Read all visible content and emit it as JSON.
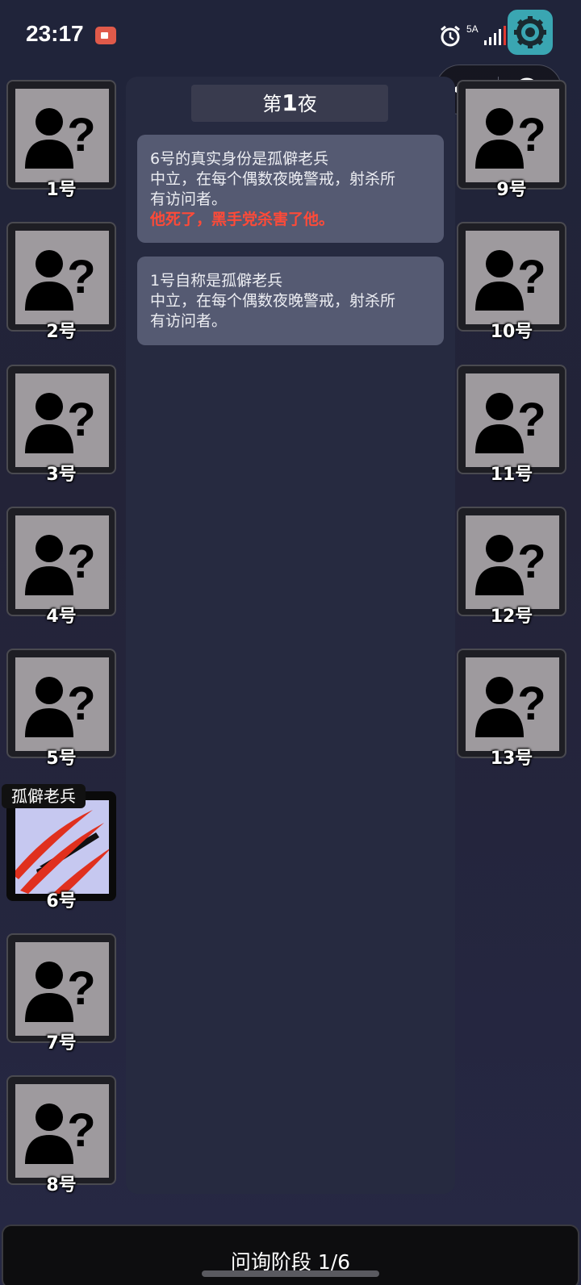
{
  "status_bar": {
    "time": "23:17",
    "network": "5A",
    "icons": [
      "record-icon",
      "alarm-icon",
      "signal-icon",
      "settings-icon"
    ]
  },
  "capsule": {
    "icons": [
      "more-icon",
      "close-target-icon"
    ]
  },
  "players_left": [
    {
      "label": "1号",
      "icon": "unknown-person-icon"
    },
    {
      "label": "2号",
      "icon": "unknown-person-icon"
    },
    {
      "label": "3号",
      "icon": "unknown-person-icon"
    },
    {
      "label": "4号",
      "icon": "unknown-person-icon"
    },
    {
      "label": "5号",
      "icon": "unknown-person-icon"
    },
    {
      "label": "6号",
      "icon": "dead-veteran-icon",
      "role": "孤僻老兵",
      "dead": true
    },
    {
      "label": "7号",
      "icon": "unknown-person-icon"
    },
    {
      "label": "8号",
      "icon": "unknown-person-icon"
    }
  ],
  "players_right": [
    {
      "label": "9号",
      "icon": "unknown-person-icon"
    },
    {
      "label": "10号",
      "icon": "unknown-person-icon"
    },
    {
      "label": "11号",
      "icon": "unknown-person-icon"
    },
    {
      "label": "12号",
      "icon": "unknown-person-icon"
    },
    {
      "label": "13号",
      "icon": "unknown-person-icon"
    }
  ],
  "night": {
    "prefix": "第",
    "number": "1",
    "suffix": "夜"
  },
  "messages": [
    {
      "lines": [
        "6号的真实身份是孤僻老兵",
        "中立，在每个偶数夜晚警戒，射杀所",
        "有访问者。"
      ],
      "alert": "他死了，黑手党杀害了他。"
    },
    {
      "lines": [
        "1号自称是孤僻老兵",
        "中立，在每个偶数夜晚警戒，射杀所",
        "有访问者。"
      ]
    }
  ],
  "phase": "问询阶段 1/6",
  "colors": {
    "background": "#232538",
    "panel": "#262a40",
    "message": "#555a72",
    "alert": "#ff4a38",
    "settings": "#3aa6b2"
  }
}
